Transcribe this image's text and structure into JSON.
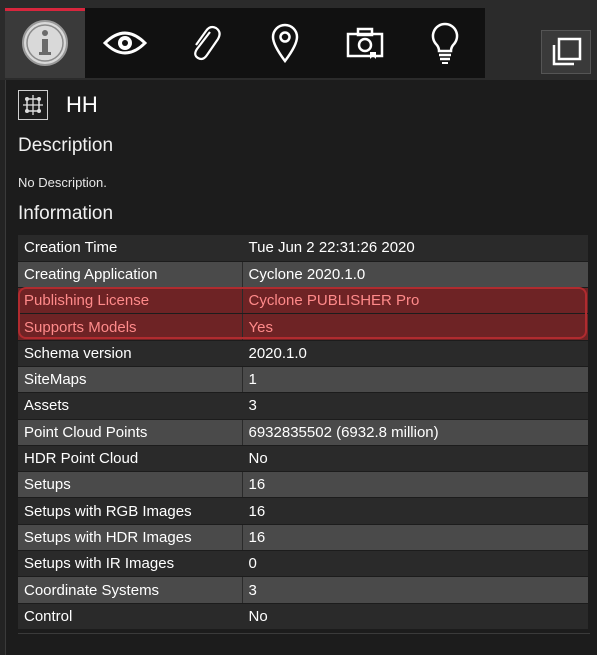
{
  "tabs": [
    {
      "name": "info",
      "icon": "info-icon",
      "active": true
    },
    {
      "name": "view",
      "icon": "eye-icon",
      "active": false
    },
    {
      "name": "attachments",
      "icon": "paperclip-icon",
      "active": false
    },
    {
      "name": "location",
      "icon": "location-pin-icon",
      "active": false
    },
    {
      "name": "snapshot",
      "icon": "camera-icon",
      "active": false
    },
    {
      "name": "tips",
      "icon": "lightbulb-icon",
      "active": false
    }
  ],
  "header": {
    "title": "HH",
    "node_icon": "point-cloud-node-icon"
  },
  "description": {
    "heading": "Description",
    "text": "No Description."
  },
  "information": {
    "heading": "Information",
    "rows": [
      {
        "key": "Creation Time",
        "value": "Tue Jun 2 22:31:26 2020"
      },
      {
        "key": "Creating Application",
        "value": "Cyclone 2020.1.0"
      },
      {
        "key": "Publishing License",
        "value": "Cyclone PUBLISHER Pro"
      },
      {
        "key": "Supports Models",
        "value": "Yes"
      },
      {
        "key": "Schema version",
        "value": "2020.1.0"
      },
      {
        "key": "SiteMaps",
        "value": "1"
      },
      {
        "key": "Assets",
        "value": "3"
      },
      {
        "key": "Point Cloud Points",
        "value": "6932835502 (6932.8 million)"
      },
      {
        "key": "HDR Point Cloud",
        "value": "No"
      },
      {
        "key": "Setups",
        "value": "16"
      },
      {
        "key": "Setups with RGB Images",
        "value": "16"
      },
      {
        "key": "Setups with HDR Images",
        "value": "16"
      },
      {
        "key": "Setups with IR Images",
        "value": "0"
      },
      {
        "key": "Coordinate Systems",
        "value": "3"
      },
      {
        "key": "Control",
        "value": "No"
      }
    ]
  },
  "colors": {
    "active_tab_accent": "#d7263d",
    "highlight_bg": "#6e2325",
    "highlight_text": "#ff8a8a",
    "highlight_outline": "#b02b2f"
  }
}
